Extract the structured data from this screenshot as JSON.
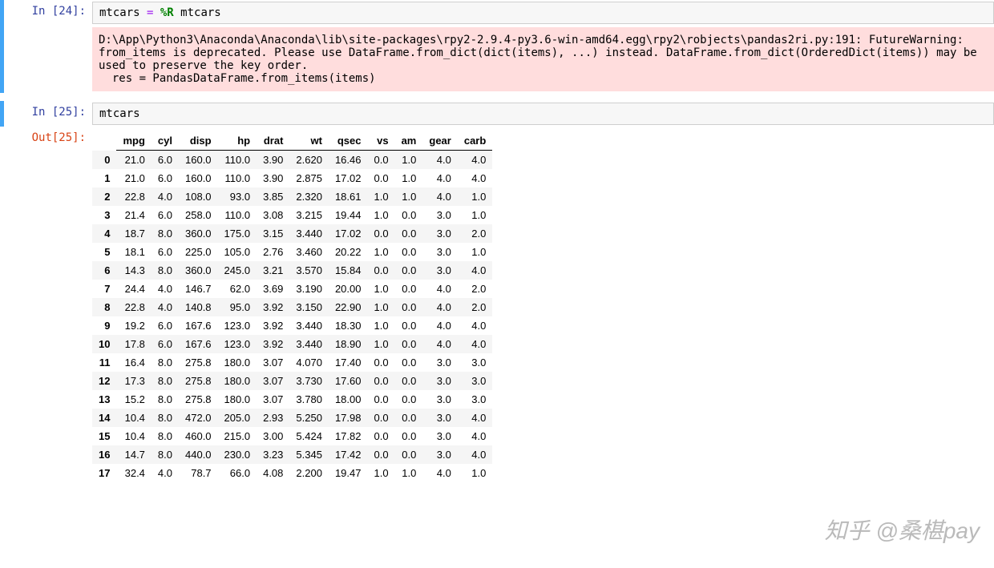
{
  "cells": {
    "c24": {
      "prompt_in": "In [24]:",
      "code_plain": "mtcars ",
      "code_op": "= ",
      "code_magic": "%R",
      "code_tail": " mtcars",
      "stderr": "D:\\App\\Python3\\Anaconda\\Anaconda\\lib\\site-packages\\rpy2-2.9.4-py3.6-win-amd64.egg\\rpy2\\robjects\\pandas2ri.py:191: FutureWarning: from_items is deprecated. Please use DataFrame.from_dict(dict(items), ...) instead. DataFrame.from_dict(OrderedDict(items)) may be used to preserve the key order.\n  res = PandasDataFrame.from_items(items)"
    },
    "c25": {
      "prompt_in": "In [25]:",
      "prompt_out": "Out[25]:",
      "code": "mtcars"
    }
  },
  "table": {
    "columns": [
      "mpg",
      "cyl",
      "disp",
      "hp",
      "drat",
      "wt",
      "qsec",
      "vs",
      "am",
      "gear",
      "carb"
    ],
    "rows": [
      {
        "idx": "0",
        "v": [
          "21.0",
          "6.0",
          "160.0",
          "110.0",
          "3.90",
          "2.620",
          "16.46",
          "0.0",
          "1.0",
          "4.0",
          "4.0"
        ]
      },
      {
        "idx": "1",
        "v": [
          "21.0",
          "6.0",
          "160.0",
          "110.0",
          "3.90",
          "2.875",
          "17.02",
          "0.0",
          "1.0",
          "4.0",
          "4.0"
        ]
      },
      {
        "idx": "2",
        "v": [
          "22.8",
          "4.0",
          "108.0",
          "93.0",
          "3.85",
          "2.320",
          "18.61",
          "1.0",
          "1.0",
          "4.0",
          "1.0"
        ]
      },
      {
        "idx": "3",
        "v": [
          "21.4",
          "6.0",
          "258.0",
          "110.0",
          "3.08",
          "3.215",
          "19.44",
          "1.0",
          "0.0",
          "3.0",
          "1.0"
        ]
      },
      {
        "idx": "4",
        "v": [
          "18.7",
          "8.0",
          "360.0",
          "175.0",
          "3.15",
          "3.440",
          "17.02",
          "0.0",
          "0.0",
          "3.0",
          "2.0"
        ]
      },
      {
        "idx": "5",
        "v": [
          "18.1",
          "6.0",
          "225.0",
          "105.0",
          "2.76",
          "3.460",
          "20.22",
          "1.0",
          "0.0",
          "3.0",
          "1.0"
        ]
      },
      {
        "idx": "6",
        "v": [
          "14.3",
          "8.0",
          "360.0",
          "245.0",
          "3.21",
          "3.570",
          "15.84",
          "0.0",
          "0.0",
          "3.0",
          "4.0"
        ]
      },
      {
        "idx": "7",
        "v": [
          "24.4",
          "4.0",
          "146.7",
          "62.0",
          "3.69",
          "3.190",
          "20.00",
          "1.0",
          "0.0",
          "4.0",
          "2.0"
        ]
      },
      {
        "idx": "8",
        "v": [
          "22.8",
          "4.0",
          "140.8",
          "95.0",
          "3.92",
          "3.150",
          "22.90",
          "1.0",
          "0.0",
          "4.0",
          "2.0"
        ]
      },
      {
        "idx": "9",
        "v": [
          "19.2",
          "6.0",
          "167.6",
          "123.0",
          "3.92",
          "3.440",
          "18.30",
          "1.0",
          "0.0",
          "4.0",
          "4.0"
        ]
      },
      {
        "idx": "10",
        "v": [
          "17.8",
          "6.0",
          "167.6",
          "123.0",
          "3.92",
          "3.440",
          "18.90",
          "1.0",
          "0.0",
          "4.0",
          "4.0"
        ]
      },
      {
        "idx": "11",
        "v": [
          "16.4",
          "8.0",
          "275.8",
          "180.0",
          "3.07",
          "4.070",
          "17.40",
          "0.0",
          "0.0",
          "3.0",
          "3.0"
        ]
      },
      {
        "idx": "12",
        "v": [
          "17.3",
          "8.0",
          "275.8",
          "180.0",
          "3.07",
          "3.730",
          "17.60",
          "0.0",
          "0.0",
          "3.0",
          "3.0"
        ]
      },
      {
        "idx": "13",
        "v": [
          "15.2",
          "8.0",
          "275.8",
          "180.0",
          "3.07",
          "3.780",
          "18.00",
          "0.0",
          "0.0",
          "3.0",
          "3.0"
        ]
      },
      {
        "idx": "14",
        "v": [
          "10.4",
          "8.0",
          "472.0",
          "205.0",
          "2.93",
          "5.250",
          "17.98",
          "0.0",
          "0.0",
          "3.0",
          "4.0"
        ]
      },
      {
        "idx": "15",
        "v": [
          "10.4",
          "8.0",
          "460.0",
          "215.0",
          "3.00",
          "5.424",
          "17.82",
          "0.0",
          "0.0",
          "3.0",
          "4.0"
        ]
      },
      {
        "idx": "16",
        "v": [
          "14.7",
          "8.0",
          "440.0",
          "230.0",
          "3.23",
          "5.345",
          "17.42",
          "0.0",
          "0.0",
          "3.0",
          "4.0"
        ]
      },
      {
        "idx": "17",
        "v": [
          "32.4",
          "4.0",
          "78.7",
          "66.0",
          "4.08",
          "2.200",
          "19.47",
          "1.0",
          "1.0",
          "4.0",
          "1.0"
        ]
      }
    ]
  },
  "watermark": "知乎 @桑椹pay"
}
